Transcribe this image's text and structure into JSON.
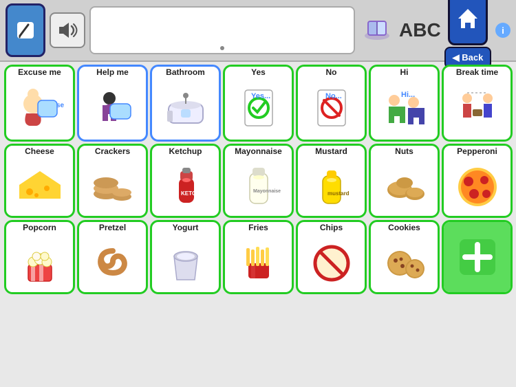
{
  "topbar": {
    "edit_label": "✏",
    "speaker_label": "🔊",
    "abc_label": "ABC",
    "back_label": "◀ Back",
    "info_label": "i"
  },
  "rows": [
    [
      {
        "id": "excuse-me",
        "label": "Excuse me",
        "emoji": "🙋",
        "border": "green"
      },
      {
        "id": "help-me",
        "label": "Help me",
        "emoji": "🆘",
        "border": "blue"
      },
      {
        "id": "bathroom",
        "label": "Bathroom",
        "emoji": "🛁",
        "border": "blue"
      },
      {
        "id": "yes",
        "label": "Yes",
        "emoji": "✅",
        "border": "green"
      },
      {
        "id": "no",
        "label": "No",
        "emoji": "🚫",
        "border": "green"
      },
      {
        "id": "hi",
        "label": "Hi",
        "emoji": "👋",
        "border": "green"
      },
      {
        "id": "break-time",
        "label": "Break time",
        "emoji": "☕",
        "border": "green"
      }
    ],
    [
      {
        "id": "cheese",
        "label": "Cheese",
        "emoji": "🧀",
        "border": "green"
      },
      {
        "id": "crackers",
        "label": "Crackers",
        "emoji": "🍞",
        "border": "green"
      },
      {
        "id": "ketchup",
        "label": "Ketchup",
        "emoji": "🍅",
        "border": "green"
      },
      {
        "id": "mayonnaise",
        "label": "Mayonnaise",
        "emoji": "🫙",
        "border": "green"
      },
      {
        "id": "mustard",
        "label": "Mustard",
        "emoji": "🟡",
        "border": "green"
      },
      {
        "id": "nuts",
        "label": "Nuts",
        "emoji": "🥜",
        "border": "green"
      },
      {
        "id": "pepperoni",
        "label": "Pepperoni",
        "emoji": "🍕",
        "border": "green"
      }
    ],
    [
      {
        "id": "popcorn",
        "label": "Popcorn",
        "emoji": "🍿",
        "border": "green"
      },
      {
        "id": "pretzel",
        "label": "Pretzel",
        "emoji": "🥨",
        "border": "green"
      },
      {
        "id": "yogurt",
        "label": "Yogurt",
        "emoji": "🍦",
        "border": "green"
      },
      {
        "id": "fries",
        "label": "Fries",
        "emoji": "🍟",
        "border": "green"
      },
      {
        "id": "chips",
        "label": "Chips",
        "emoji": "🚫",
        "border": "green"
      },
      {
        "id": "cookies",
        "label": "Cookies",
        "emoji": "🍪",
        "border": "green"
      },
      {
        "id": "add",
        "label": "",
        "emoji": "",
        "border": "green",
        "isAdd": true
      }
    ]
  ]
}
